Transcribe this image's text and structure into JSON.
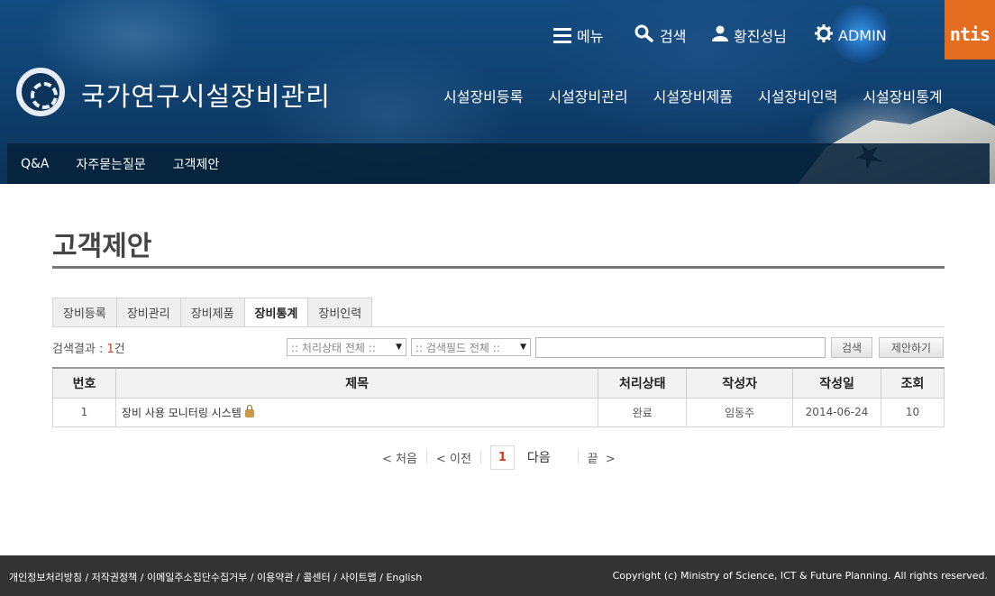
{
  "header": {
    "site_title": "국가연구시설장비관리",
    "util": {
      "menu": "메뉴",
      "search": "검색",
      "user": "황진성님",
      "admin": "ADMIN"
    },
    "brand_logo": "ntis",
    "gnb": [
      "시설장비등록",
      "시설장비관리",
      "시설장비제품",
      "시설장비인력",
      "시설장비통계"
    ],
    "subnav": [
      "Q&A",
      "자주묻는질문",
      "고객제안"
    ]
  },
  "page": {
    "title": "고객제안"
  },
  "tabs": [
    {
      "label": "장비등록",
      "active": false
    },
    {
      "label": "장비관리",
      "active": false
    },
    {
      "label": "장비제품",
      "active": false
    },
    {
      "label": "장비통계",
      "active": true
    },
    {
      "label": "장비인력",
      "active": false
    }
  ],
  "search": {
    "result_prefix": "검색결과 : ",
    "result_count": "1",
    "result_suffix": "건",
    "status_select": ":: 처리상태 전체 ::",
    "field_select": ":: 검색필드 전체 ::",
    "keyword": "",
    "search_button": "검색",
    "propose_button": "제안하기"
  },
  "table": {
    "headers": [
      "번호",
      "제목",
      "처리상태",
      "작성자",
      "작성일",
      "조회"
    ],
    "rows": [
      {
        "no": "1",
        "title": "장비 사용 모니터링 시스템",
        "status": "완료",
        "author": "임동주",
        "date": "2014-06-24",
        "views": "10"
      }
    ]
  },
  "pagination": {
    "first": "< 처음",
    "prev": "< 이전",
    "current": "1",
    "next": "다음",
    "last": "끝  >"
  },
  "footer": {
    "links": [
      "개인정보처리방침",
      "저작권정책",
      "이메일주소집단수집거부",
      "이용약관",
      "콜센터",
      "사이트맵",
      "English"
    ],
    "copyright": "Copyright (c) Ministry of Science, ICT & Future Planning. All rights reserved."
  },
  "colors": {
    "accent": "#d23b1f",
    "brand": "#e56d1f",
    "header_bg": "#134c80",
    "footer_bg": "#333333"
  }
}
